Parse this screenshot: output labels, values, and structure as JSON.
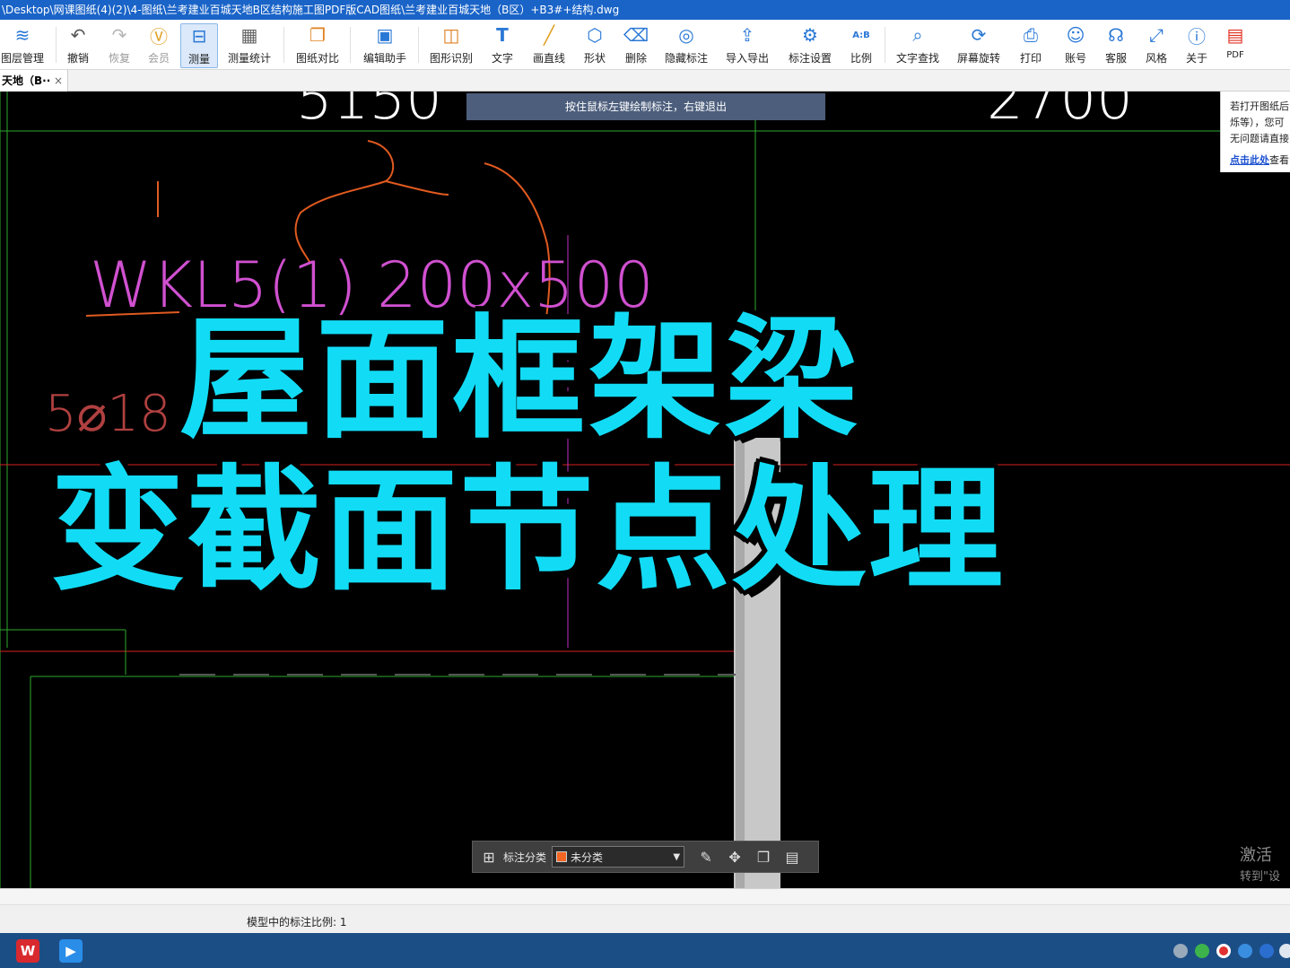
{
  "window": {
    "title": "\\Desktop\\网课图纸(4)(2)\\4-图纸\\兰考建业百城天地B区结构施工图PDF版CAD图纸\\兰考建业百城天地（B区）+B3#+结构.dwg"
  },
  "toolbar": {
    "items": [
      {
        "label": "图层管理",
        "icon": "layers-icon"
      },
      {
        "label": "撤销",
        "icon": "undo-icon"
      },
      {
        "label": "恢复",
        "icon": "redo-icon"
      },
      {
        "label": "会员",
        "icon": "vip-icon"
      },
      {
        "label": "测量",
        "icon": "measure-icon"
      },
      {
        "label": "测量统计",
        "icon": "measure-stats-icon"
      },
      {
        "label": "图纸对比",
        "icon": "compare-icon"
      },
      {
        "label": "编辑助手",
        "icon": "edit-assistant-icon"
      },
      {
        "label": "图形识别",
        "icon": "shape-recognition-icon"
      },
      {
        "label": "文字",
        "icon": "text-icon"
      },
      {
        "label": "画直线",
        "icon": "line-icon"
      },
      {
        "label": "形状",
        "icon": "shape-icon"
      },
      {
        "label": "删除",
        "icon": "eraser-icon"
      },
      {
        "label": "隐藏标注",
        "icon": "hide-annotation-icon"
      },
      {
        "label": "导入导出",
        "icon": "import-export-icon"
      },
      {
        "label": "标注设置",
        "icon": "annotation-settings-icon"
      },
      {
        "label": "比例",
        "icon": "scale-icon"
      },
      {
        "label": "文字查找",
        "icon": "text-search-icon"
      },
      {
        "label": "屏幕旋转",
        "icon": "rotate-screen-icon"
      },
      {
        "label": "打印",
        "icon": "print-icon"
      },
      {
        "label": "账号",
        "icon": "account-icon"
      },
      {
        "label": "客服",
        "icon": "headset-icon"
      },
      {
        "label": "风格",
        "icon": "style-icon"
      },
      {
        "label": "关于",
        "icon": "info-icon"
      },
      {
        "label": "PDF",
        "icon": "pdf-icon"
      }
    ],
    "scale_icon_text": "A:B"
  },
  "tab": {
    "label": "天地（B··",
    "close": "×"
  },
  "canvas": {
    "hint": "按住鼠标左键绘制标注，右键退出",
    "drawing_text": {
      "dim_left": "5150",
      "dim_right": "2700",
      "beam_label": "WKL5(1) 200x500",
      "rebar": "5⌀18"
    },
    "notice": {
      "line1": "若打开图纸后",
      "line2": "烁等），您可",
      "line3": "无问题请直接",
      "link": "点击此处",
      "link_suffix": "查看"
    },
    "overlay": {
      "line1": "屋面框架梁",
      "line2": "变截面节点处理"
    },
    "annotation_bar": {
      "category_label": "标注分类",
      "selected": "未分类",
      "swatch_color": "#f26522"
    },
    "watermark": {
      "line1": "激活",
      "line2": "转到\"设"
    }
  },
  "status": {
    "text": "模型中的标注比例: 1"
  },
  "colors": {
    "accent": "#1a64c8",
    "overlay_text": "#12dcf5",
    "canvas": "#000000",
    "hint_bg": "#4c5e7c"
  }
}
